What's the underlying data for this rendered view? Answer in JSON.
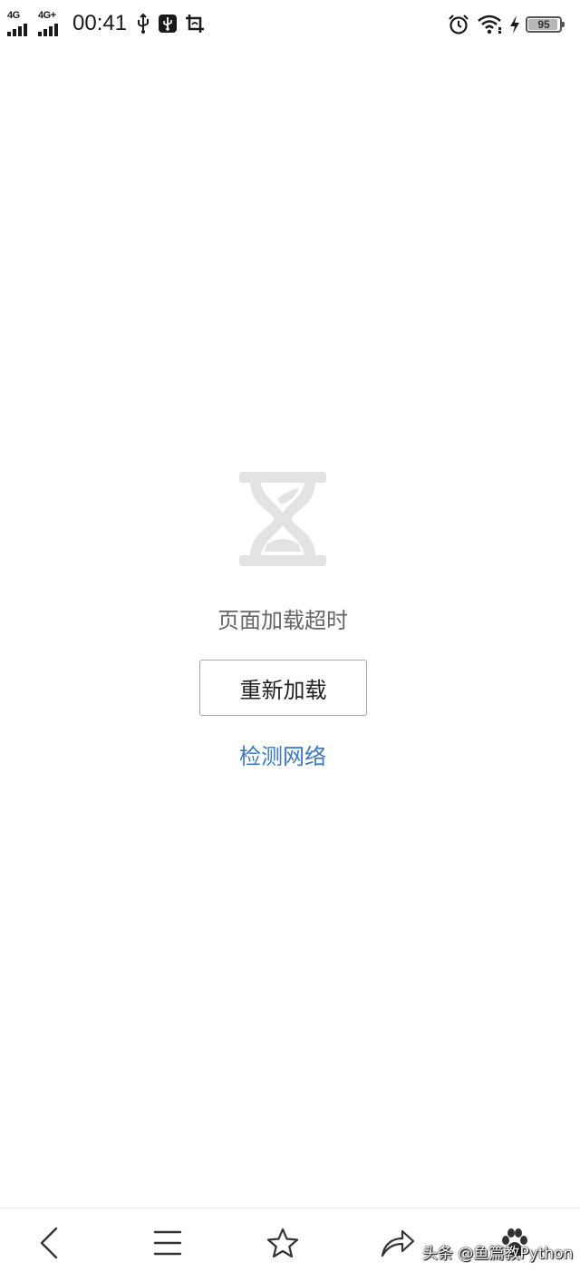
{
  "status_bar": {
    "time": "00:41",
    "network_1": "4G",
    "network_2": "4G+",
    "battery_level": "95",
    "battery_percent": 95,
    "icons": [
      "usb-icon",
      "usb-debug-icon",
      "screenshot-icon",
      "alarm-icon",
      "wifi-icon",
      "charging-icon",
      "battery-icon"
    ]
  },
  "main": {
    "icon": "hourglass-icon",
    "timeout_message": "页面加载超时",
    "reload_button": "重新加载",
    "check_network_link": "检测网络"
  },
  "bottom_nav": {
    "items": [
      "back-icon",
      "menu-icon",
      "star-icon",
      "share-icon",
      "paw-icon"
    ]
  },
  "watermark": "头条 @鱼篇教Python",
  "colors": {
    "link": "#3a78c9",
    "muted_text": "#666666",
    "hourglass": "#e3e3e3",
    "icon_dark": "#333333"
  }
}
